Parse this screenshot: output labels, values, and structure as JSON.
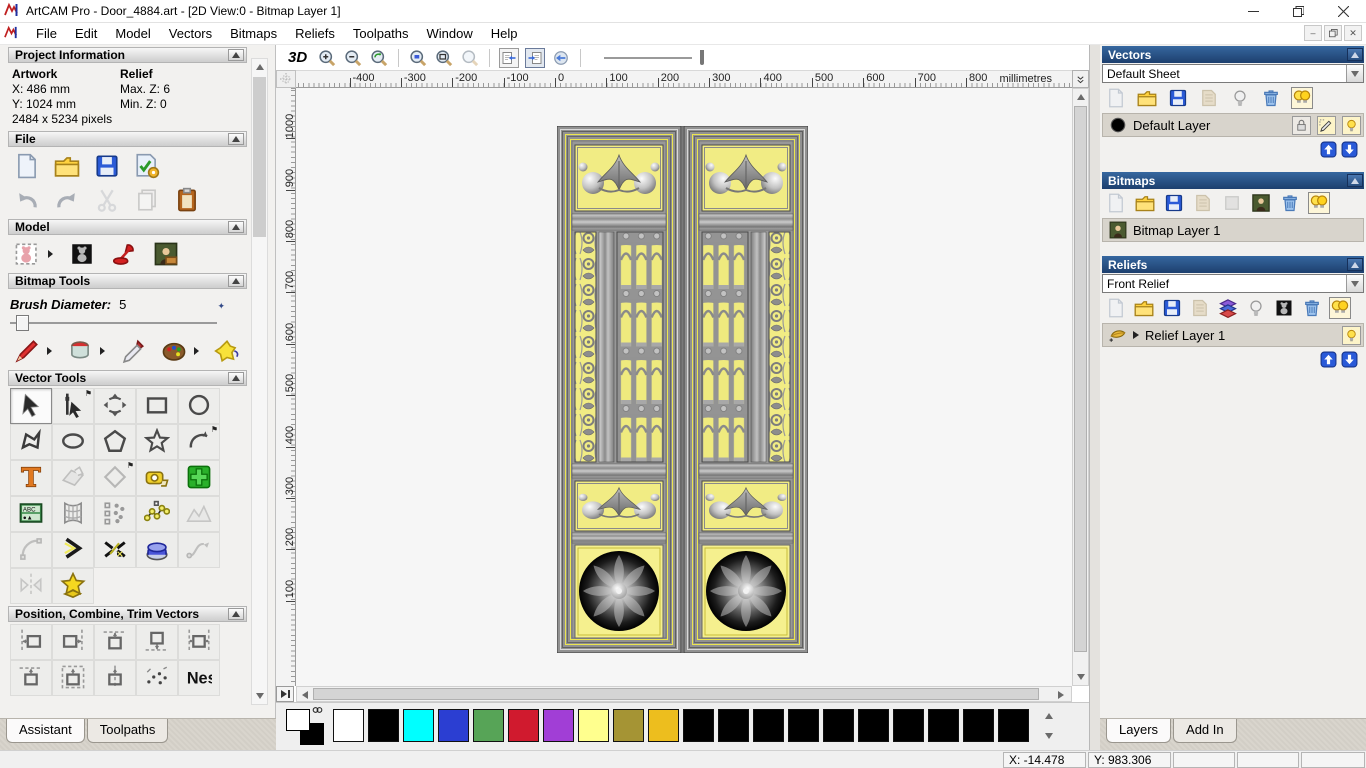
{
  "window": {
    "title": "ArtCAM Pro - Door_4884.art - [2D View:0 - Bitmap Layer 1]"
  },
  "menu": [
    "File",
    "Edit",
    "Model",
    "Vectors",
    "Bitmaps",
    "Reliefs",
    "Toolpaths",
    "Window",
    "Help"
  ],
  "assistant": {
    "project_information": {
      "title": "Project Information",
      "artwork_label": "Artwork",
      "relief_label": "Relief",
      "x": "X: 486 mm",
      "y": "Y: 1024 mm",
      "pixels": "2484 x 5234 pixels",
      "max_z": "Max. Z: 6",
      "min_z": "Min. Z: 0"
    },
    "file_section": {
      "title": "File",
      "row1": [
        "new-model-icon",
        "open-icon",
        "save-icon",
        "model-properties-icon"
      ],
      "row2": [
        "undo-icon",
        "redo-icon",
        "cut-icon~",
        "copy-icon~",
        "paste-icon"
      ]
    },
    "model_section": {
      "title": "Model",
      "icons": [
        "import-model-icon*",
        "greyscale-model-icon",
        "lighting-icon",
        "texture-relief-icon"
      ]
    },
    "bitmap_tools": {
      "title": "Bitmap Tools",
      "brush_label": "Brush Diameter:",
      "brush_value": "5",
      "icons": [
        "paint-brush-icon*",
        "paint-bucket-icon*",
        "colour-picker-icon",
        "palette-icon*",
        "flood-fill-icon"
      ]
    },
    "vector_tools": {
      "title": "Vector Tools",
      "rows": [
        [
          "select-vectors-icon!",
          "node-editing-icon^",
          "transform-vectors-icon",
          "create-rectangle-icon",
          "create-circle-icon"
        ],
        [
          "create-polyline-icon",
          "create-ellipse-icon",
          "create-polygon-icon",
          "create-star-icon",
          "create-arc-icon^"
        ],
        [
          "create-text-icon",
          "wrap-text-icon~",
          "distort-vector-icon~^",
          "measure-icon",
          "paste-centre-icon"
        ],
        [
          "text-in-box-icon",
          "envelope-distortion-icon",
          "nesting-icon",
          "fit-polyline-icon",
          "fit-sketch-icon~"
        ],
        [
          "fit-arcs-icon~",
          "join-vectors-icon",
          "trim-vectors-icon",
          "extrude-vector-icon",
          "blend-spans-icon~"
        ],
        [
          "mirror-vectors-icon~",
          "wrap-star-icon"
        ]
      ]
    },
    "position_section": {
      "title": "Position, Combine, Trim Vectors",
      "row1": [
        "align-left-icon",
        "align-right-icon",
        "align-top-icon",
        "align-bottom-icon",
        "centre-horizontal-icon"
      ],
      "row2": [
        "centre-in-page-icon",
        "centre-in-page-alt-icon",
        "align-centre-icon",
        "spray-points-icon",
        "nest-vectors-icon"
      ]
    },
    "tabs": [
      {
        "label": "Assistant",
        "active": true
      },
      {
        "label": "Toolpaths",
        "active": false
      }
    ]
  },
  "canvas": {
    "toolbar": {
      "label_3d": "3D",
      "icons": [
        "zoom-in-icon",
        "zoom-out-icon",
        "zoom-previous-icon",
        "|",
        "zoom-ratio-icon",
        "zoom-objects-icon",
        "zoom-drawing-icon~",
        "|",
        "toggle-link-view-icon",
        "toggle-link-view2-icon!",
        "pan-view-icon",
        "|",
        "slider"
      ]
    },
    "h_ruler": {
      "unit": "millimetres",
      "min": -400,
      "max": 800,
      "step": 100
    },
    "v_ruler": {
      "min": 100,
      "max": 1000,
      "step": 100
    }
  },
  "panels": {
    "vectors": {
      "title": "Vectors",
      "sheet": "Default Sheet",
      "toolbar": [
        "new-vector-layer-icon~",
        "open-vector-layer-icon",
        "save-vector-layer-icon",
        "merge-vector-layers-icon~",
        "toggle-visibility-icon",
        "delete-layer-icon",
        "show-all-layers-icon!"
      ],
      "layer": {
        "name": "Default Layer",
        "swatch": "#000000",
        "buttons": [
          "lock-icon",
          "snap-edit-icon!",
          "visibility-bulb-icon!"
        ]
      }
    },
    "bitmaps": {
      "title": "Bitmaps",
      "toolbar": [
        "new-bitmap-layer-icon~",
        "open-bitmap-layer-icon",
        "save-bitmap-layer-icon",
        "merge-bitmap-layers-icon~",
        "blank-layer-icon~",
        "greyscale-layer-icon",
        "delete-layer-icon",
        "show-all-layers-icon!"
      ],
      "layer": {
        "name": "Bitmap Layer 1"
      }
    },
    "reliefs": {
      "title": "Reliefs",
      "combo": "Front Relief",
      "toolbar": [
        "new-relief-layer-icon~",
        "open-relief-layer-icon",
        "save-relief-layer-icon",
        "merge-relief-layers-icon~",
        "stack-layers-icon",
        "toggle-visibility-icon",
        "greyscale-relief-icon",
        "delete-layer-icon",
        "show-all-layers-icon!"
      ],
      "layer": {
        "name": "Relief Layer 1",
        "buttons": [
          "visibility-bulb-icon!"
        ]
      }
    },
    "tabs": [
      {
        "label": "Layers",
        "active": true
      },
      {
        "label": "Add In",
        "active": false
      }
    ]
  },
  "palette": {
    "indicator": {
      "primary": "#ffffff",
      "secondary": "#000000"
    },
    "swatches": [
      "#ffffff",
      "#000000",
      "#00ffff",
      "#2b3ed2",
      "#57a457",
      "#d01a2e",
      "#a13ed6",
      "#ffff8e",
      "#a59434",
      "#edbe1e",
      "#000000",
      "#000000",
      "#000000",
      "#000000",
      "#000000",
      "#000000",
      "#000000",
      "#000000",
      "#000000",
      "#000000"
    ]
  },
  "status": {
    "x": "X: -14.478",
    "y": "Y: 983.306"
  },
  "colors": {
    "header_blue": "#2a5a9e",
    "door_yellow": "#f1ec84",
    "door_grey": "#919191"
  }
}
